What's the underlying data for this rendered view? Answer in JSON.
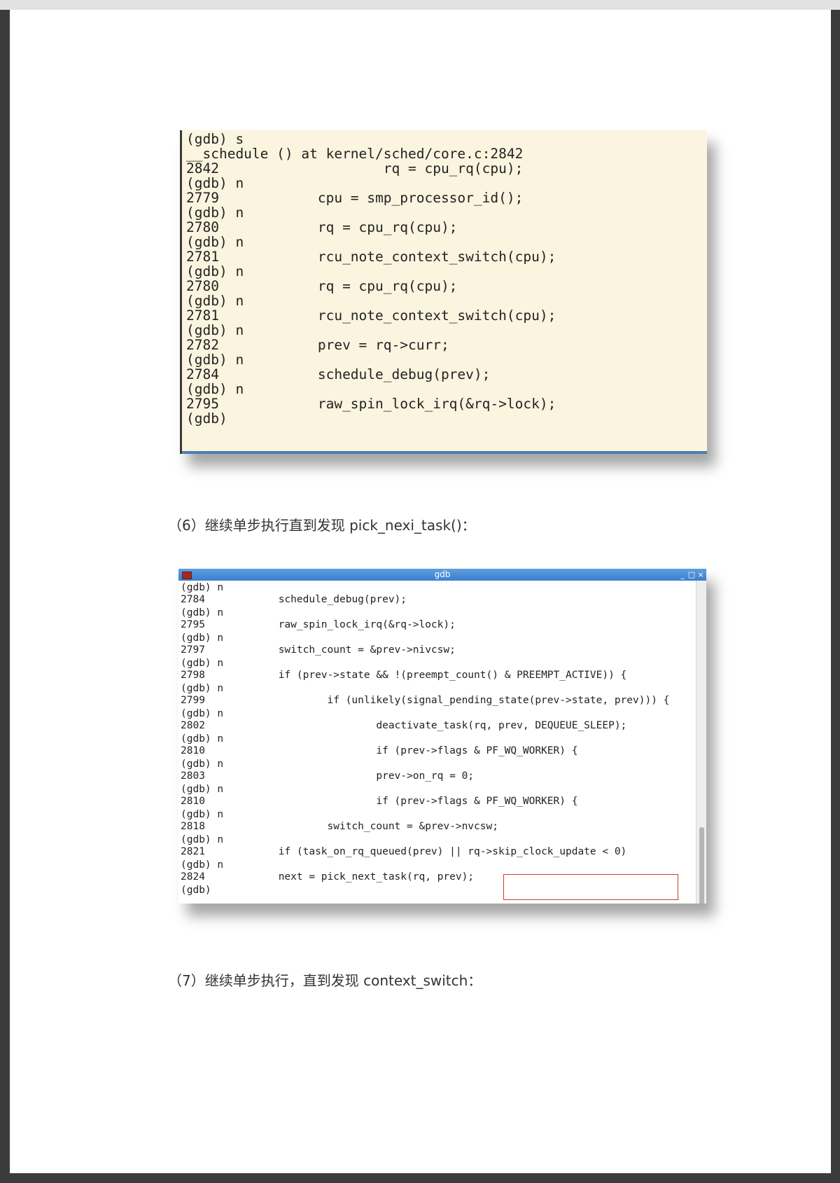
{
  "shot1": {
    "lines": [
      "(gdb) s",
      "__schedule () at kernel/sched/core.c:2842",
      "2842\t\t\trq = cpu_rq(cpu);",
      "(gdb) n",
      "2779\t\tcpu = smp_processor_id();",
      "(gdb) n",
      "2780\t\trq = cpu_rq(cpu);",
      "(gdb) n",
      "2781\t\trcu_note_context_switch(cpu);",
      "(gdb) n",
      "2780\t\trq = cpu_rq(cpu);",
      "(gdb) n",
      "2781\t\trcu_note_context_switch(cpu);",
      "(gdb) n",
      "2782\t\tprev = rq->curr;",
      "(gdb) n",
      "2784\t\tschedule_debug(prev);",
      "(gdb) n",
      "2795\t\traw_spin_lock_irq(&rq->lock);",
      "(gdb)"
    ]
  },
  "caption6": "（6）继续单步执行直到发现 pick_nexi_task()：",
  "shot2": {
    "window_title": "gdb",
    "window_buttons": {
      "minimize": "_",
      "maximize": "□",
      "close": "×"
    },
    "lines": [
      "(gdb) n",
      "2784\t\tschedule_debug(prev);",
      "(gdb) n",
      "2795\t\traw_spin_lock_irq(&rq->lock);",
      "(gdb) n",
      "2797\t\tswitch_count = &prev->nivcsw;",
      "(gdb) n",
      "2798\t\tif (prev->state && !(preempt_count() & PREEMPT_ACTIVE)) {",
      "(gdb) n",
      "2799\t\t\tif (unlikely(signal_pending_state(prev->state, prev))) {",
      "(gdb) n",
      "2802\t\t\t\tdeactivate_task(rq, prev, DEQUEUE_SLEEP);",
      "(gdb) n",
      "2810\t\t\t\tif (prev->flags & PF_WQ_WORKER) {",
      "(gdb) n",
      "2803\t\t\t\tprev->on_rq = 0;",
      "(gdb) n",
      "2810\t\t\t\tif (prev->flags & PF_WQ_WORKER) {",
      "(gdb) n",
      "2818\t\t\tswitch_count = &prev->nvcsw;",
      "(gdb) n",
      "2821\t\tif (task_on_rq_queued(prev) || rq->skip_clock_update < 0)",
      "(gdb) n",
      "2824\t\tnext = pick_next_task(rq, prev);",
      "(gdb)"
    ]
  },
  "caption7": "（7）继续单步执行，直到发现 context_switch："
}
